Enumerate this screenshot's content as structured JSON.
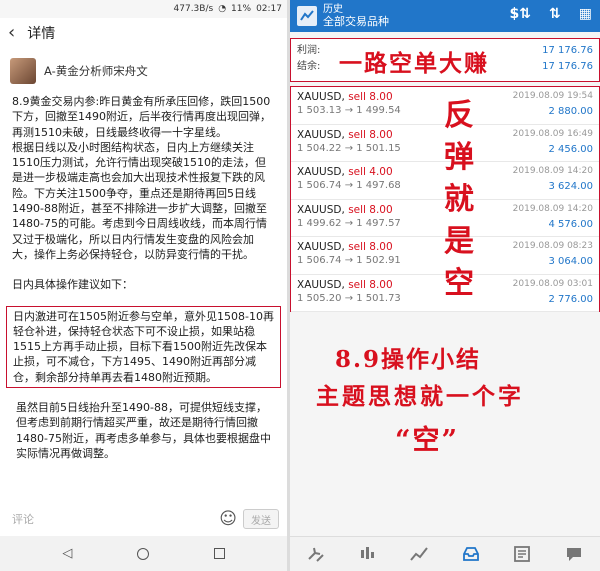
{
  "left": {
    "status": {
      "speed": "477.3B/s",
      "battery": "11%",
      "time": "02:17"
    },
    "nav": {
      "back_icon": "chevron-left-icon",
      "title": "详情"
    },
    "author": "A-黄金分析师宋舟文",
    "paragraph1": "8.9黄金交易内参:昨日黄金有所承压回修，跌回1500下方，回撤至1490附近，后半夜行情再度出现回弹，再测1510未破，日线最终收得一十字星线。",
    "paragraph2": "根据日线以及小时图结构状态，日内上方继续关注1510压力测试，允许行情出现突破1510的走法，但是进一步极端走高也会加大出现技术性报复下跌的风险。下方关注1500争夺，重点还是期待再回5日线1490-88附近，甚至不排除进一步扩大调整，回撤至1480-75的可能。考虑到今日周线收线，而本周行情又过于极端化，所以日内行情发生变盘的风险会加大，操作上务必保持轻仓，以防异变行情的干扰。",
    "paragraph3": "日内具体操作建议如下：",
    "boxed": "日内激进可在1505附近参与空单，意外见1508-10再轻仓补进，保持轻仓状态下可不设止损，如果站稳1515上方再手动止损，目标下看1500附近先改保本止损，可不减仓，下方1495、1490附近再部分减仓，剩余部分持单再去看1480附近预期。",
    "paragraph4": "虽然目前5日线抬升至1490-88，可提供短线支撑，但考虑到前期行情超买严重，故还是期待行情回撤1480-75附近，再考虑多单参与，具体也要根据盘中实际情况再做调整。",
    "comment_placeholder": "评论",
    "emoji_icon": "emoji-icon",
    "send_label": "发送"
  },
  "right": {
    "header": {
      "title_small": "历史",
      "title": "全部交易品种"
    },
    "summary": [
      {
        "key": "利润:",
        "value": "17 176.76"
      },
      {
        "key": "结余:",
        "value": "17 176.76"
      }
    ],
    "banner": "一路空单大赚",
    "trades": [
      {
        "symbol": "XAUUSD,",
        "side": "sell 8.00",
        "prices": "1 503.13 → 1 499.54",
        "date": "2019.08.09 19:54",
        "profit": "2 880.00"
      },
      {
        "symbol": "XAUUSD,",
        "side": "sell 8.00",
        "prices": "1 504.22 → 1 501.15",
        "date": "2019.08.09 16:49",
        "profit": "2 456.00"
      },
      {
        "symbol": "XAUUSD,",
        "side": "sell 4.00",
        "prices": "1 506.74 → 1 497.68",
        "date": "2019.08.09 14:20",
        "profit": "3 624.00"
      },
      {
        "symbol": "XAUUSD,",
        "side": "sell 8.00",
        "prices": "1 499.62 → 1 497.57",
        "date": "2019.08.09 14:20",
        "profit": "4 576.00"
      },
      {
        "symbol": "XAUUSD,",
        "side": "sell 8.00",
        "prices": "1 506.74 → 1 502.91",
        "date": "2019.08.09 08:23",
        "profit": "3 064.00"
      },
      {
        "symbol": "XAUUSD,",
        "side": "sell 8.00",
        "prices": "1 505.20 → 1 501.73",
        "date": "2019.08.09 03:01",
        "profit": "2 776.00"
      }
    ],
    "vertical_chars": [
      "反",
      "弹",
      "就",
      "是",
      "空"
    ],
    "summary_line1": "8.9操作小结",
    "summary_line2": "主题思想就一个字",
    "summary_line3": "“空”",
    "tab_icons": [
      "quotes-icon",
      "chart-icon",
      "trade-icon",
      "history-icon",
      "news-icon",
      "chat-icon"
    ]
  },
  "colors": {
    "accent_blue": "#2176c9",
    "annotation_red": "#d8101e"
  }
}
